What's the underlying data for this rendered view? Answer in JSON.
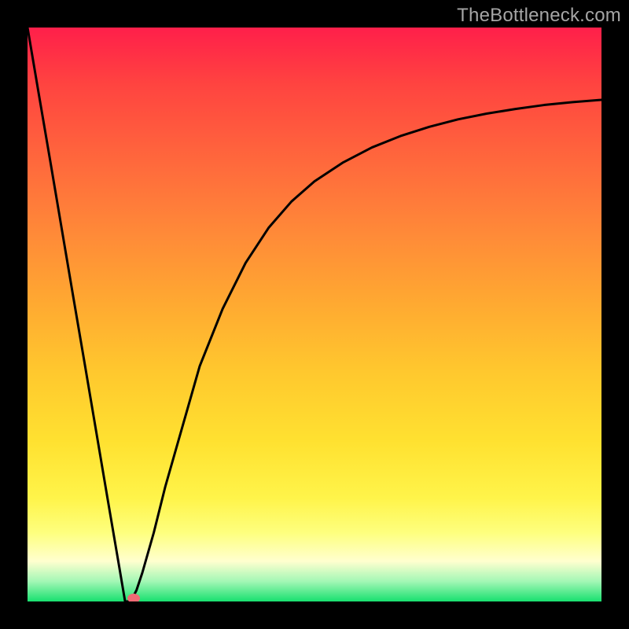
{
  "watermark": "TheBottleneck.com",
  "chart_data": {
    "type": "line",
    "title": "",
    "xlabel": "",
    "ylabel": "",
    "xlim": [
      0,
      100
    ],
    "ylim": [
      0,
      100
    ],
    "grid": false,
    "x": [
      0,
      2,
      4,
      6,
      8,
      10,
      12,
      14,
      16,
      17,
      18,
      19,
      20,
      22,
      24,
      26,
      28,
      30,
      34,
      38,
      42,
      46,
      50,
      55,
      60,
      65,
      70,
      75,
      80,
      85,
      90,
      95,
      100
    ],
    "values": [
      100,
      88.2,
      76.5,
      64.7,
      52.9,
      41.2,
      29.4,
      17.6,
      5.9,
      0,
      0,
      2,
      5,
      12,
      20,
      27,
      34,
      41,
      51,
      59,
      65.1,
      69.7,
      73.2,
      76.5,
      79.1,
      81.1,
      82.7,
      84,
      85,
      85.8,
      86.5,
      87,
      87.4
    ],
    "marker": {
      "x": 18.5,
      "y": 0
    },
    "note": "Values estimated from plotted curve; y=0 is bottom (green), y=100 is top (red)."
  },
  "colors": {
    "gradient_top": "#ff1f4a",
    "gradient_mid": "#ffe130",
    "gradient_bottom": "#18e06f",
    "marker": "#ef6a74",
    "frame": "#000000"
  }
}
